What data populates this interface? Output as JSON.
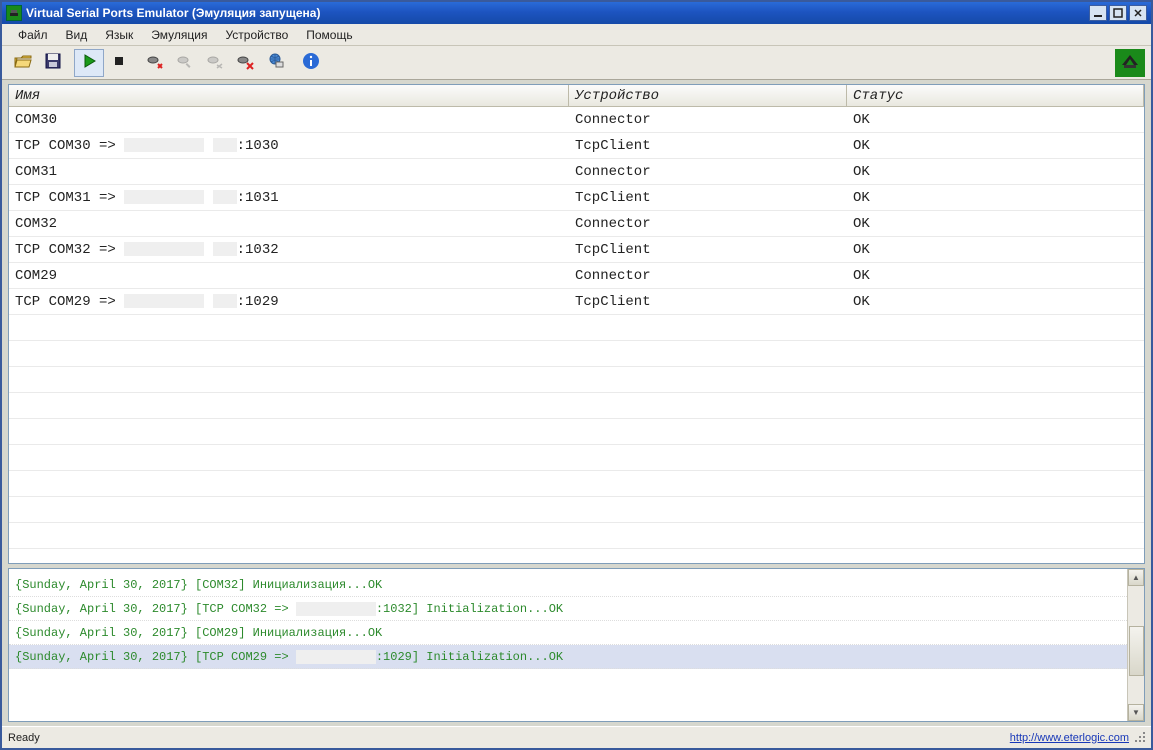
{
  "title": "Virtual Serial Ports Emulator (Эмуляция запущена)",
  "menu": {
    "file": "Файл",
    "view": "Вид",
    "lang": "Язык",
    "emu": "Эмуляция",
    "device": "Устройство",
    "help": "Помощь"
  },
  "toolbar": {
    "open": "open-icon",
    "save": "save-icon",
    "play": "play-icon",
    "stop": "stop-icon",
    "newdev": "device-new-icon",
    "editdev": "device-edit-icon",
    "recondev": "device-reconnect-icon",
    "deldev": "device-delete-icon",
    "netdev": "device-network-icon",
    "info": "info-icon"
  },
  "columns": {
    "name": "Имя",
    "device": "Устройство",
    "status": "Статус"
  },
  "rows": [
    {
      "name": "COM30",
      "redact": false,
      "suffix": "",
      "device": "Connector",
      "status": "OK"
    },
    {
      "name": "TCP COM30 => ",
      "redact": true,
      "suffix": ":1030",
      "device": "TcpClient",
      "status": "OK"
    },
    {
      "name": "COM31",
      "redact": false,
      "suffix": "",
      "device": "Connector",
      "status": "OK"
    },
    {
      "name": "TCP COM31 => ",
      "redact": true,
      "suffix": ":1031",
      "device": "TcpClient",
      "status": "OK"
    },
    {
      "name": "COM32",
      "redact": false,
      "suffix": "",
      "device": "Connector",
      "status": "OK"
    },
    {
      "name": "TCP COM32 => ",
      "redact": true,
      "suffix": ":1032",
      "device": "TcpClient",
      "status": "OK"
    },
    {
      "name": "COM29",
      "redact": false,
      "suffix": "",
      "device": "Connector",
      "status": "OK"
    },
    {
      "name": "TCP COM29 => ",
      "redact": true,
      "suffix": ":1029",
      "device": "TcpClient",
      "status": "OK"
    }
  ],
  "empty_rows": 9,
  "log": [
    {
      "prefix": "{Sunday, April 30, 2017} [COM32] Инициализация...OK",
      "redact": false,
      "suffix": "",
      "sel": false
    },
    {
      "prefix": "{Sunday, April 30, 2017} [TCP COM32 => ",
      "redact": true,
      "suffix": ":1032] Initialization...OK",
      "sel": false
    },
    {
      "prefix": "{Sunday, April 30, 2017} [COM29] Инициализация...OK",
      "redact": false,
      "suffix": "",
      "sel": false
    },
    {
      "prefix": "{Sunday, April 30, 2017} [TCP COM29 => ",
      "redact": true,
      "suffix": ":1029] Initialization...OK",
      "sel": true
    }
  ],
  "status": {
    "ready": "Ready",
    "url": "http://www.eterlogic.com"
  }
}
